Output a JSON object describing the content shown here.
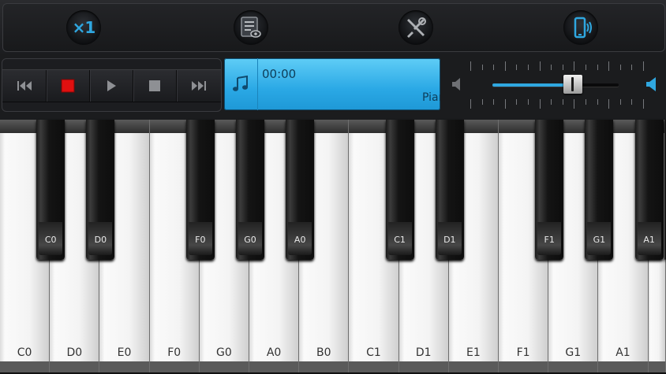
{
  "toolbar": {
    "speed_label": "×1",
    "icons": [
      "speed-multiplier-icon",
      "song-list-icon",
      "settings-tools-icon",
      "phone-vibrate-icon"
    ],
    "accent": "#2fa7e0"
  },
  "transport": {
    "buttons": [
      "rewind-to-start",
      "record",
      "play",
      "stop",
      "skip-to-end"
    ],
    "record_color": "#e01010"
  },
  "display": {
    "time": "00:00",
    "track": "Piano",
    "bg": "#2aa8e5"
  },
  "volume": {
    "level": 0.64
  },
  "keyboard": {
    "white_keys": [
      "C0",
      "D0",
      "E0",
      "F0",
      "G0",
      "A0",
      "B0",
      "C1",
      "D1",
      "E1",
      "F1",
      "G1",
      "A1"
    ],
    "black_keys": [
      "C0",
      "D0",
      "F0",
      "G0",
      "A0",
      "C1",
      "D1",
      "F1",
      "G1",
      "A1"
    ]
  }
}
